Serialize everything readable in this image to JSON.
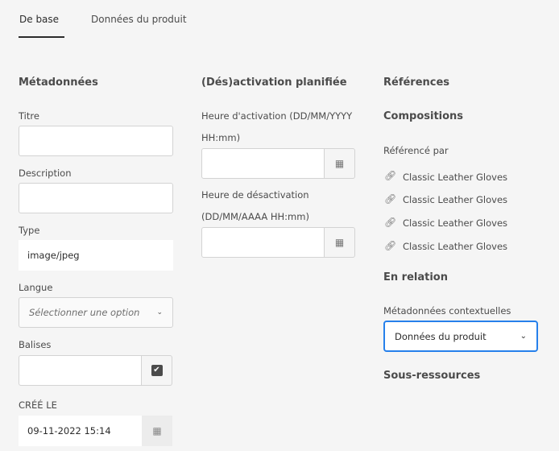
{
  "tabs": [
    {
      "label": "De base"
    },
    {
      "label": "Données du produit"
    }
  ],
  "metadata": {
    "heading": "Métadonnées",
    "title_label": "Titre",
    "title_value": "",
    "description_label": "Description",
    "description_value": "",
    "type_label": "Type",
    "type_value": "image/jpeg",
    "language_label": "Langue",
    "language_placeholder": "Sélectionner une option",
    "tags_label": "Balises",
    "created_label": "CRÉÉ LE",
    "created_value": "09-11-2022 15:14"
  },
  "schedule": {
    "heading": "(Dés)activation planifiée",
    "on_label_1": "Heure d'activation (DD/MM/YYYY",
    "on_label_2": "HH:mm)",
    "off_label_1": "Heure de désactivation",
    "off_label_2": "(DD/MM/AAAA HH:mm)"
  },
  "references": {
    "heading": "Références",
    "compositions": "Compositions",
    "referenced_by": "Référencé par",
    "items": [
      "Classic Leather Gloves",
      "Classic Leather Gloves",
      "Classic Leather Gloves",
      "Classic Leather Gloves"
    ],
    "related": "En relation",
    "context_label": "Métadonnées contextuelles",
    "context_value": "Données du produit",
    "subresources": "Sous-ressources"
  },
  "colors": {
    "focus": "#2680eb"
  }
}
